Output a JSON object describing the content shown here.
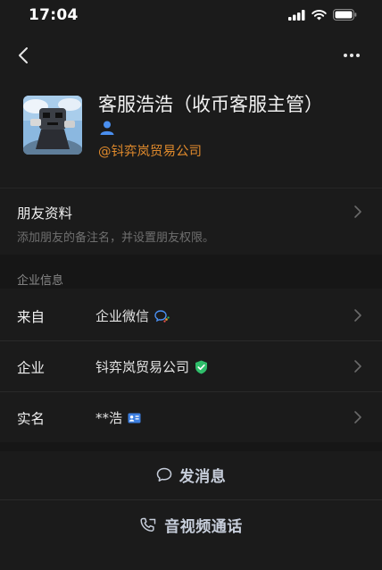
{
  "status_bar": {
    "time": "17:04"
  },
  "profile": {
    "name": "客服浩浩（收币客服主管）",
    "company": "@钭弈岚贸易公司",
    "person_icon": "person-icon",
    "person_icon_color": "#4a8ff0",
    "company_color": "#e08a2c"
  },
  "friend_info": {
    "title": "朋友资料",
    "subtitle": "添加朋友的备注名，并设置朋友权限。"
  },
  "enterprise": {
    "section_label": "企业信息",
    "rows": [
      {
        "label": "来自",
        "value": "企业微信",
        "icon": "wecom-icon"
      },
      {
        "label": "企业",
        "value": "钭弈岚贸易公司",
        "icon": "verified-shield-icon"
      },
      {
        "label": "实名",
        "value": "**浩",
        "icon": "id-card-icon"
      }
    ]
  },
  "actions": {
    "message": "发消息",
    "call": "音视频通话"
  },
  "colors": {
    "background": "#1b1b1b",
    "verified_green": "#2fbd6a",
    "accent_blue": "#4a8ff0"
  }
}
